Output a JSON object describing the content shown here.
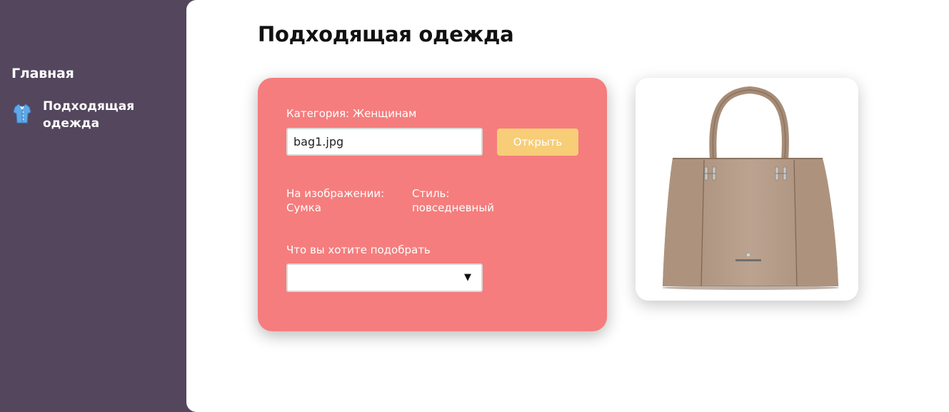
{
  "sidebar": {
    "home_label": "Главная",
    "items": [
      {
        "label": "Подходящая одежда",
        "icon": "shirt-icon"
      }
    ]
  },
  "main": {
    "title": "Подходящая одежда",
    "form": {
      "category_text": "Категория: Женщинам",
      "file_value": "bag1.jpg",
      "open_label": "Открыть",
      "image_label": "На изображении:",
      "image_value": "Сумка",
      "style_label": "Стиль:",
      "style_value": "повседневный",
      "pick_label": "Что вы хотите подобрать",
      "select_value": ""
    },
    "photo": {
      "subject": "handbag-image"
    }
  },
  "colors": {
    "sidebar_bg": "#53465d",
    "card_bg": "#f57d7d",
    "button_bg": "#f8cd77",
    "bag_color": "#b59b86"
  }
}
